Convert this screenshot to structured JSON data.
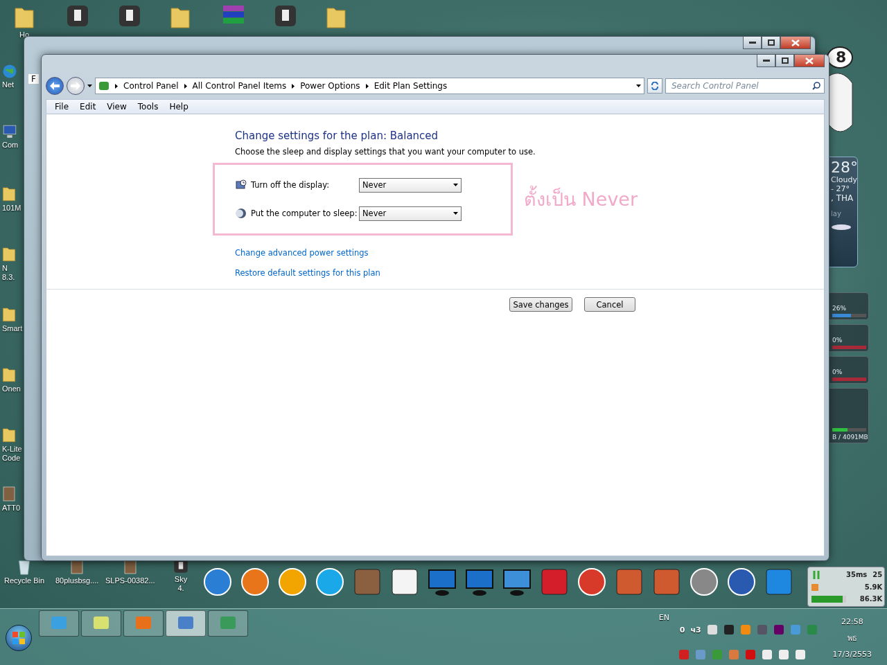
{
  "desktop": {
    "top_icons": [
      {
        "kind": "folder",
        "label": "Ho"
      },
      {
        "kind": "app"
      },
      {
        "kind": "app"
      },
      {
        "kind": "folder"
      },
      {
        "kind": "books"
      },
      {
        "kind": "app"
      },
      {
        "kind": "folder"
      }
    ],
    "left_icons": [
      {
        "kind": "globe",
        "label": "Net"
      },
      {
        "kind": "computer",
        "label": "Com"
      },
      {
        "kind": "folder",
        "label": "101M"
      },
      {
        "kind": "folder",
        "label": "N\n8.3."
      },
      {
        "kind": "folder",
        "label": "Smart"
      },
      {
        "kind": "folder",
        "label": "Onen"
      },
      {
        "kind": "folder",
        "label": "K-Lite\nCode"
      },
      {
        "kind": "picture",
        "label": "ATT0"
      }
    ],
    "bottom_icons": [
      {
        "kind": "bin",
        "label": "Recycle Bin"
      },
      {
        "kind": "picture",
        "label": "80plusbsg...."
      },
      {
        "kind": "picture",
        "label": "SLPS-00382..."
      },
      {
        "kind": "app",
        "label": "Sky\n4."
      }
    ]
  },
  "back_window": {
    "menu_letter": "F"
  },
  "window": {
    "breadcrumb": [
      "Control Panel",
      "All Control Panel Items",
      "Power Options",
      "Edit Plan Settings"
    ],
    "search": {
      "placeholder": "Search Control Panel"
    },
    "menu": [
      "File",
      "Edit",
      "View",
      "Tools",
      "Help"
    ],
    "heading": "Change settings for the plan: Balanced",
    "description": "Choose the sleep and display settings that you want your computer to use.",
    "settings": [
      {
        "kind": "display",
        "label": "Turn off the display:",
        "value": "Never"
      },
      {
        "kind": "sleep",
        "label": "Put the computer to sleep:",
        "value": "Never"
      }
    ],
    "links": [
      "Change advanced power settings",
      "Restore default settings for this plan"
    ],
    "buttons": [
      "Save changes",
      "Cancel"
    ]
  },
  "annotation": "ตั้งเป็น Never",
  "sticker": "8",
  "weather": {
    "temperature": "28°",
    "condition": "Cloudy",
    "range": "- 27°",
    "location": ", THA",
    "line_5": "lay"
  },
  "cpu_meters": [
    {
      "reading": "26%",
      "level": 0.55
    },
    {
      "reading": "0%"
    },
    {
      "reading": "0%"
    }
  ],
  "memory_meter": {
    "reading": "B / 4091MB",
    "level": 0.45
  },
  "dock": [
    {
      "kind": "round",
      "color": "#2a7fd4"
    },
    {
      "kind": "round",
      "color": "#e8751a"
    },
    {
      "kind": "round",
      "color": "#f2a400"
    },
    {
      "kind": "round",
      "color": "#1aa8e8"
    },
    {
      "kind": "square",
      "color": "#8a6040"
    },
    {
      "kind": "square",
      "color": "#f4f4f4"
    },
    {
      "kind": "monitor",
      "color": "#1c6fc8"
    },
    {
      "kind": "monitor",
      "color": "#1c6fc8"
    },
    {
      "kind": "monitor",
      "color": "#3d8fd8"
    },
    {
      "kind": "square",
      "color": "#d41e2a"
    },
    {
      "kind": "round",
      "color": "#d83a2a"
    },
    {
      "kind": "square",
      "color": "#d05a30"
    },
    {
      "kind": "square",
      "color": "#d05a30"
    },
    {
      "kind": "round",
      "color": "#888888"
    },
    {
      "kind": "round",
      "color": "#2a5ab0"
    },
    {
      "kind": "square",
      "color": "#1e88e0"
    }
  ],
  "net_meter": {
    "ping": "35ms",
    "count": "25",
    "upload": "5.9K",
    "download": "86.3K",
    "level": 0.9
  },
  "taskbar": {
    "buttons": [
      {
        "selected": false
      },
      {
        "selected": false
      },
      {
        "selected": false
      },
      {
        "selected": true
      },
      {
        "selected": false
      }
    ],
    "language": "EN",
    "tray_texts": [
      "0",
      "ч3"
    ],
    "time": "22:58",
    "day": "พธ",
    "date": "17/3/2553"
  }
}
